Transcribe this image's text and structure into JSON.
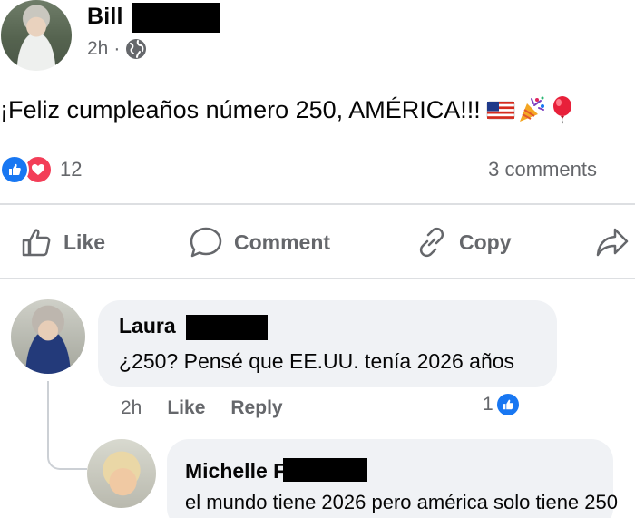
{
  "post": {
    "author": "Bill",
    "time": "2h",
    "separator": "·",
    "text": "¡Feliz cumpleaños número 250, AMÉRICA!!!",
    "emojis": [
      "us-flag-icon",
      "party-popper-icon",
      "balloon-icon"
    ],
    "reaction_count": "12",
    "comments_label": "3 comments"
  },
  "actions": {
    "like": "Like",
    "comment": "Comment",
    "copy": "Copy",
    "share_icon": "share-arrow-icon"
  },
  "comments": [
    {
      "author": "Laura",
      "text": "¿250? Pensé que EE.UU. tenía 2026 años",
      "time": "2h",
      "like_label": "Like",
      "reply_label": "Reply",
      "like_count": "1"
    },
    {
      "author": "Michelle F",
      "text": "el mundo tiene 2026 pero américa solo tiene 250"
    }
  ],
  "colors": {
    "facebook_blue": "#1877f2",
    "love_red": "#f33e58",
    "meta_gray": "#65676b",
    "bubble_bg": "#f0f2f5",
    "divider": "#dddfe2"
  }
}
